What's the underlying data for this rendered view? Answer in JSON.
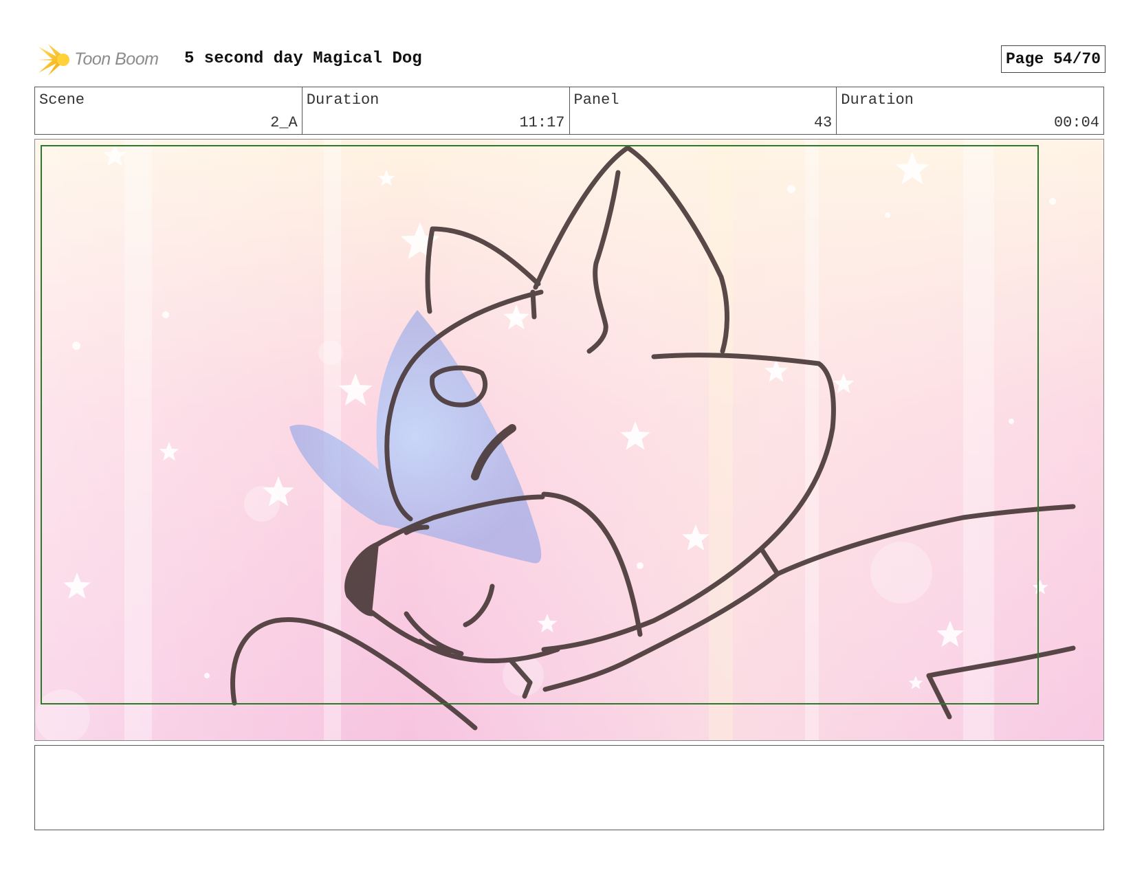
{
  "header": {
    "logo_text": "Toon Boom",
    "title": "5 second day Magical Dog",
    "page": "Page 54/70"
  },
  "info": [
    {
      "label": "Scene",
      "value": "2_A"
    },
    {
      "label": "Duration",
      "value": "11:17"
    },
    {
      "label": "Panel",
      "value": "43"
    },
    {
      "label": "Duration",
      "value": "00:04"
    }
  ],
  "colors": {
    "frame_border": "#2a7a2a",
    "line_art": "#4a3a3a",
    "wing": "#9aaae6",
    "background_pink": "#f9c6dc",
    "background_cream": "#fff1dc"
  },
  "icons": [
    "toon-boom-logo-icon"
  ]
}
